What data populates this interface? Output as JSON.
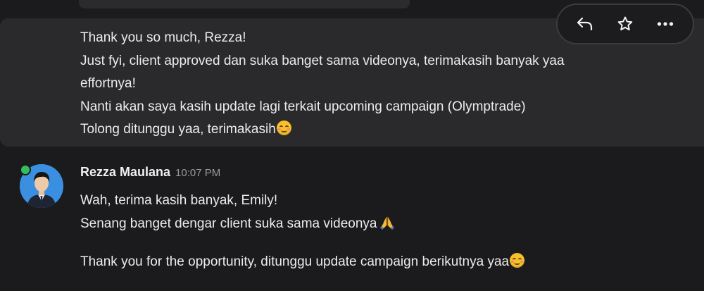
{
  "previous_message": {
    "lines": [
      "Thank you so much, Rezza!",
      "Just fyi, client approved dan suka banget sama videonya, terimakasih banyak yaa",
      "effortnya!",
      "Nanti akan saya kasih update lagi terkait upcoming campaign (Olymptrade)",
      "Tolong ditunggu yaa, terimakasih"
    ],
    "trailing_emoji": "smiling-face-with-blush-emoji"
  },
  "toolbar": {
    "reply_icon": "reply-icon",
    "star_icon": "star-icon",
    "more_icon": "more-icon"
  },
  "reply_message": {
    "sender": "Rezza Maulana",
    "time": "10:07 PM",
    "paragraph1": [
      "Wah, terima kasih banyak, Emily!",
      "Senang banget dengar client suka sama videonya"
    ],
    "paragraph2": "Thank you for the opportunity, ditunggu update campaign berikutnya yaa"
  },
  "colors": {
    "background": "#1b1b1d",
    "hover_background": "#2a2a2c",
    "online_status": "#31c05b",
    "avatar_background": "#3a8fe0"
  }
}
